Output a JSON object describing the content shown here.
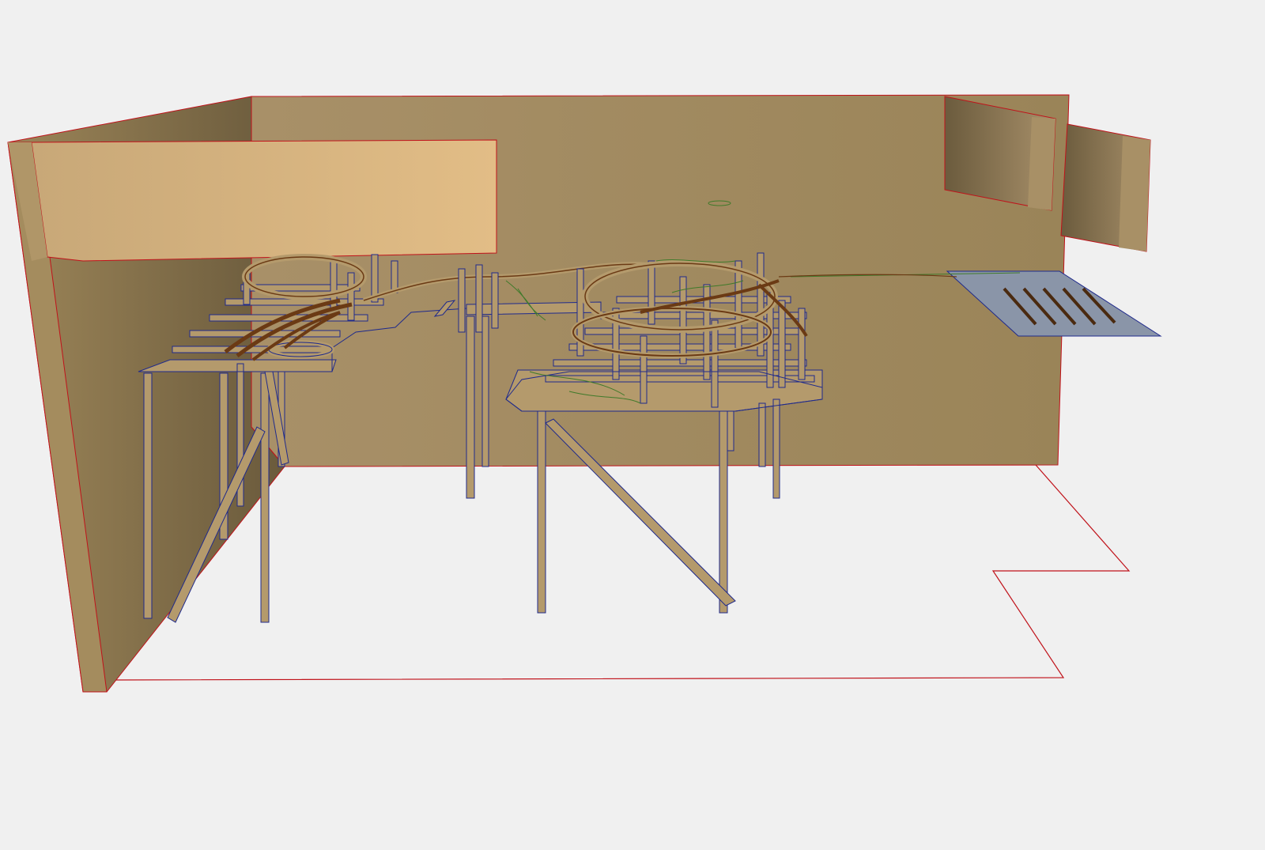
{
  "scene": {
    "description_visible_text": "",
    "colors": {
      "background": "#f0f0f0",
      "wall": "#a08a5e",
      "wall_light": "#d4b37e",
      "wall_dark": "#6e5e40",
      "edge_red": "#c0121a",
      "edge_blue": "#1f2a8c",
      "benchwork": "#b49a6c",
      "track_brown": "#6b3a14",
      "scenery_green": "#3f7a2a",
      "yard_grey": "#8a95a8"
    }
  }
}
